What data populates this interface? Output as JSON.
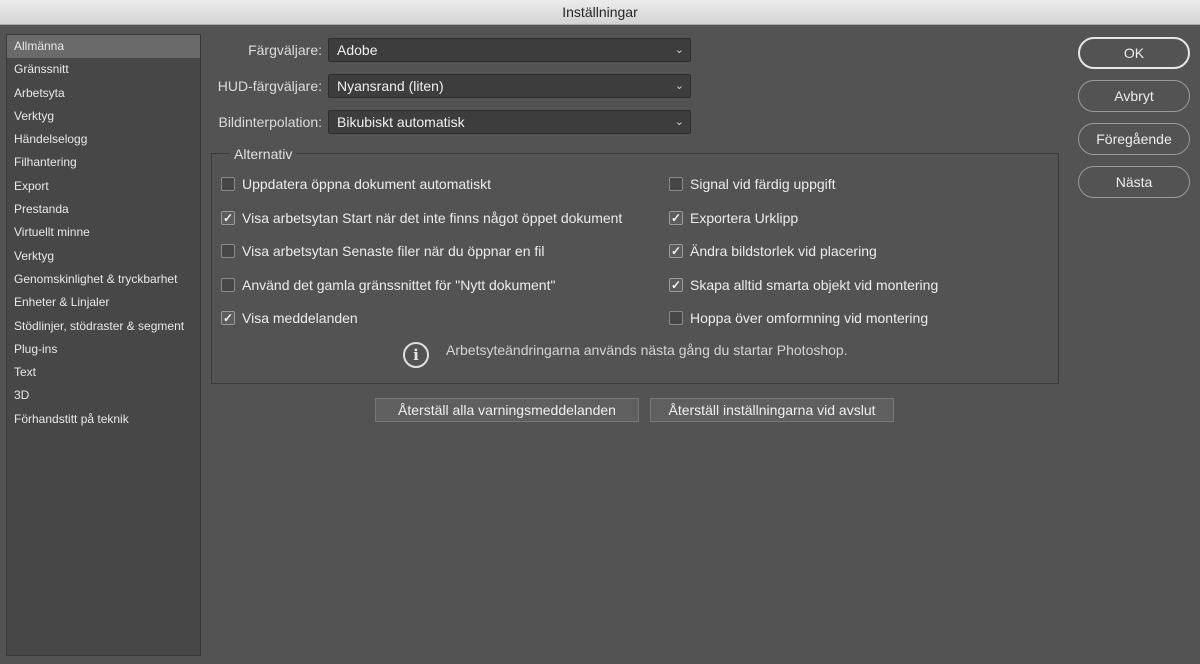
{
  "window": {
    "title": "Inställningar"
  },
  "sidebar": {
    "items": [
      {
        "label": "Allmänna",
        "selected": true
      },
      {
        "label": "Gränssnitt"
      },
      {
        "label": "Arbetsyta"
      },
      {
        "label": "Verktyg"
      },
      {
        "label": "Händelselogg"
      },
      {
        "label": "Filhantering"
      },
      {
        "label": "Export"
      },
      {
        "label": "Prestanda"
      },
      {
        "label": "Virtuellt minne"
      },
      {
        "label": "Verktyg"
      },
      {
        "label": "Genomskinlighet & tryckbarhet"
      },
      {
        "label": "Enheter & Linjaler"
      },
      {
        "label": "Stödlinjer, stödraster & segment"
      },
      {
        "label": "Plug-ins"
      },
      {
        "label": "Text"
      },
      {
        "label": "3D"
      },
      {
        "label": "Förhandstitt på teknik"
      }
    ]
  },
  "form": {
    "color_picker": {
      "label": "Färgväljare:",
      "value": "Adobe"
    },
    "hud_color_picker": {
      "label": "HUD-färgväljare:",
      "value": "Nyansrand (liten)"
    },
    "image_interpolation": {
      "label": "Bildinterpolation:",
      "value": "Bikubiskt automatisk"
    }
  },
  "options": {
    "title": "Alternativ",
    "left": [
      {
        "label": "Uppdatera öppna dokument automatiskt",
        "checked": false
      },
      {
        "label": "Visa arbetsytan Start när det inte finns något öppet dokument",
        "checked": true
      },
      {
        "label": "Visa arbetsytan Senaste filer när du öppnar en fil",
        "checked": false
      },
      {
        "label": "Använd det gamla gränssnittet för \"Nytt dokument\"",
        "checked": false
      },
      {
        "label": "Visa meddelanden",
        "checked": true
      }
    ],
    "right": [
      {
        "label": "Signal vid färdig uppgift",
        "checked": false
      },
      {
        "label": "Exportera Urklipp",
        "checked": true
      },
      {
        "label": "Ändra bildstorlek vid placering",
        "checked": true
      },
      {
        "label": "Skapa alltid smarta objekt vid montering",
        "checked": true
      },
      {
        "label": "Hoppa över omformning vid montering",
        "checked": false
      }
    ],
    "info_text": "Arbetsyteändringarna används nästa gång du startar Photoshop."
  },
  "reset_buttons": {
    "warnings": "Återställ alla varningsmeddelanden",
    "preferences": "Återställ inställningarna vid avslut"
  },
  "dialog_buttons": {
    "ok": "OK",
    "cancel": "Avbryt",
    "previous": "Föregående",
    "next": "Nästa"
  },
  "icons": {
    "info": "info-icon",
    "chevron": "chevron-down-icon",
    "checkmark": "checkmark-icon"
  }
}
